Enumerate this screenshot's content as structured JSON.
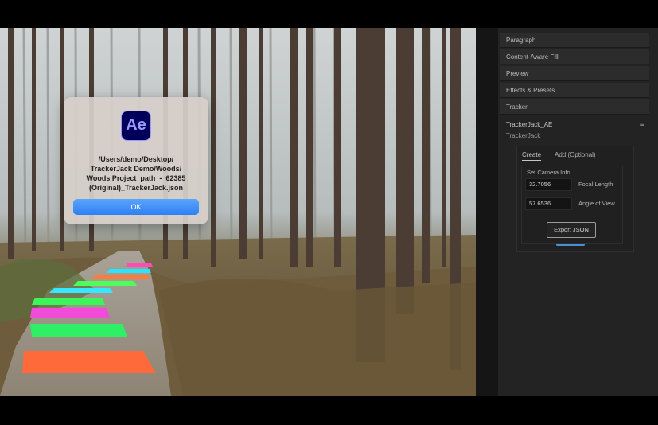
{
  "dialog": {
    "app_icon_text": "Ae",
    "message_lines": [
      "/Users/demo/Desktop/",
      "TrackerJack Demo/Woods/",
      "Woods Project_path_-_62385",
      "(Original)_TrackerJack.json"
    ],
    "ok_label": "OK"
  },
  "panels": {
    "items": [
      "Paragraph",
      "Content-Aware Fill",
      "Preview",
      "Effects & Presets",
      "Tracker"
    ],
    "trackerjack": {
      "header": "TrackerJack_AE",
      "menu_icon": "≡",
      "subtitle": "TrackerJack",
      "tabs": [
        "Create",
        "Add (Optional)"
      ],
      "camera": {
        "title": "Set Camera Info",
        "focal_length_value": "32.7056",
        "focal_length_label": "Focal Length",
        "angle_value": "57.6536",
        "angle_label": "Angle of View",
        "export_label": "Export JSON"
      }
    }
  },
  "colors": {
    "accent_blue": "#3b86f5",
    "ae_purple": "#9999ff",
    "ae_bg": "#00005b"
  }
}
